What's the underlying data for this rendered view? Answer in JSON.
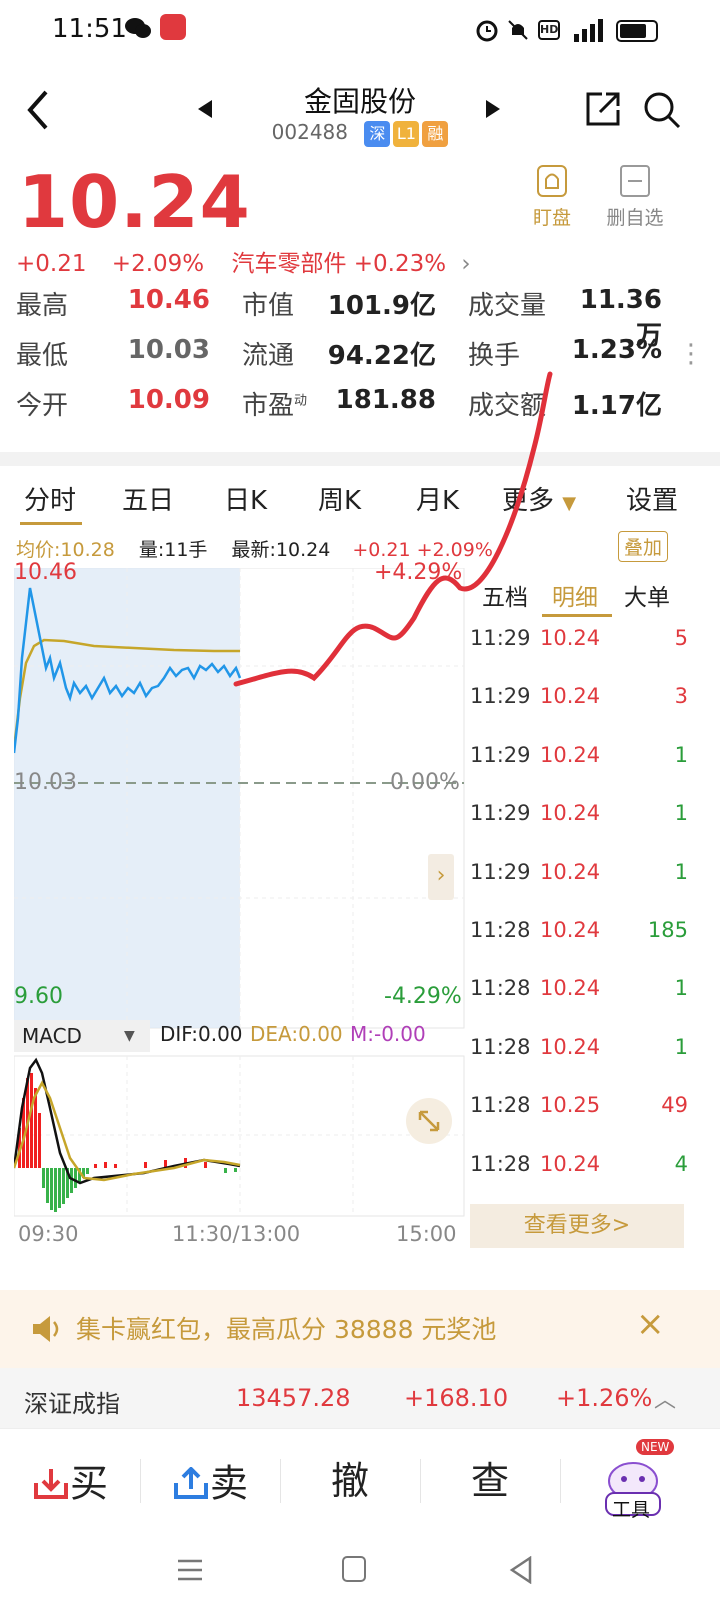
{
  "status": {
    "time": "11:51"
  },
  "header": {
    "title": "金固股份",
    "code": "002488",
    "tags": [
      "深",
      "L1",
      "融"
    ]
  },
  "quote": {
    "price": "10.24",
    "change": "+0.21",
    "change_pct": "+2.09%",
    "sector": "汽车零部件 +0.23%"
  },
  "actions": {
    "watch_label": "盯盘",
    "remove_label": "删自选"
  },
  "stats": {
    "high_label": "最高",
    "high": "10.46",
    "low_label": "最低",
    "low": "10.03",
    "open_label": "今开",
    "open": "10.09",
    "mcap_label": "市值",
    "mcap": "101.9亿",
    "float_label": "流通",
    "float": "94.22亿",
    "pe_label": "市盈",
    "pe_sup": "动",
    "pe": "181.88",
    "vol_label": "成交量",
    "vol": "11.36万",
    "turnover_label": "换手",
    "turnover": "1.23%",
    "amount_label": "成交额",
    "amount": "1.17亿"
  },
  "tabs": {
    "t1": "分时",
    "t2": "五日",
    "t3": "日K",
    "t4": "周K",
    "t5": "月K",
    "t6": "更多",
    "t7": "设置"
  },
  "legend": {
    "avg": "均价:10.28",
    "vol": "量:11手",
    "latest": "最新:10.24",
    "chg": "+0.21 +2.09%",
    "overlay": "叠加"
  },
  "chart_labels": {
    "top_price": "10.46",
    "top_pct": "+4.29%",
    "mid_price": "10.03",
    "mid_pct": "0.00%",
    "bot_price": "9.60",
    "bot_pct": "-4.29%"
  },
  "macd": {
    "name": "MACD",
    "dif": "DIF:0.00",
    "dea": "DEA:0.00",
    "m": "M:-0.00"
  },
  "time_axis": {
    "t1": "09:30",
    "t2": "11:30/13:00",
    "t3": "15:00"
  },
  "deal_tabs": {
    "a": "五档",
    "b": "明细",
    "c": "大单"
  },
  "deals": [
    {
      "time": "11:29",
      "price": "10.24",
      "vol": "5",
      "dir": "red"
    },
    {
      "time": "11:29",
      "price": "10.24",
      "vol": "3",
      "dir": "red"
    },
    {
      "time": "11:29",
      "price": "10.24",
      "vol": "1",
      "dir": "green"
    },
    {
      "time": "11:29",
      "price": "10.24",
      "vol": "1",
      "dir": "green"
    },
    {
      "time": "11:29",
      "price": "10.24",
      "vol": "1",
      "dir": "green"
    },
    {
      "time": "11:28",
      "price": "10.24",
      "vol": "185",
      "dir": "green"
    },
    {
      "time": "11:28",
      "price": "10.24",
      "vol": "1",
      "dir": "green"
    },
    {
      "time": "11:28",
      "price": "10.24",
      "vol": "1",
      "dir": "green"
    },
    {
      "time": "11:28",
      "price": "10.25",
      "vol": "49",
      "dir": "red"
    },
    {
      "time": "11:28",
      "price": "10.24",
      "vol": "4",
      "dir": "green"
    }
  ],
  "more_btn": "查看更多>",
  "banner": {
    "text": "集卡赢红包，最高瓜分 38888 元奖池"
  },
  "index": {
    "name": "深证成指",
    "value": "13457.28",
    "change": "+168.10",
    "pct": "+1.26%"
  },
  "bottom": {
    "buy": "买",
    "sell": "卖",
    "cancel": "撤",
    "query": "查",
    "tools": "工具",
    "new_badge": "NEW"
  },
  "colors": {
    "red": "#e0393e",
    "green": "#2a9d3a",
    "gold": "#c69a3c",
    "blue_line": "#2196e8"
  }
}
